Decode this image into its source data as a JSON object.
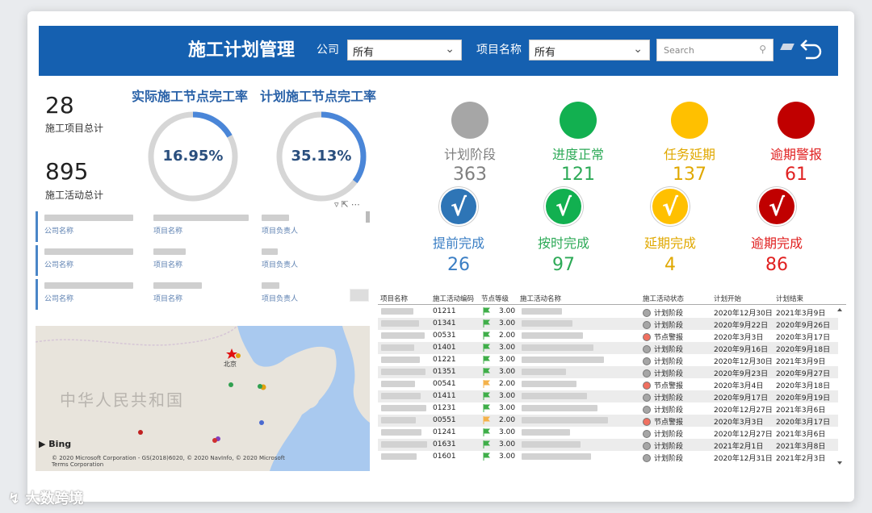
{
  "header": {
    "title": "施工计划管理",
    "company_label": "公司",
    "company_value": "所有",
    "project_label": "项目名称",
    "project_value": "所有",
    "search_placeholder": "Search"
  },
  "stats": {
    "projects_total": "28",
    "projects_label": "施工项目总计",
    "activities_total": "895",
    "activities_label": "施工活动总计"
  },
  "gauges": [
    {
      "title": "实际施工节点完工率",
      "value": "16.95%",
      "fraction": 0.1695
    },
    {
      "title": "计划施工节点完工率",
      "value": "35.13%",
      "fraction": 0.3513
    }
  ],
  "status_counts": [
    {
      "label": "计划阶段",
      "value": "363",
      "color": "#a6a6a6",
      "text_color": "#7f7f7f"
    },
    {
      "label": "进度正常",
      "value": "121",
      "color": "#12b050",
      "text_color": "#2daa57"
    },
    {
      "label": "任务延期",
      "value": "137",
      "color": "#ffc000",
      "text_color": "#e0a800"
    },
    {
      "label": "逾期警报",
      "value": "61",
      "color": "#c00000",
      "text_color": "#e02020"
    }
  ],
  "completion_counts": [
    {
      "label": "提前完成",
      "value": "26",
      "color": "#2e75b6",
      "text_color": "#3a7ec4",
      "check": "√"
    },
    {
      "label": "按时完成",
      "value": "97",
      "color": "#12b050",
      "text_color": "#2daa57",
      "check": "√"
    },
    {
      "label": "延期完成",
      "value": "4",
      "color": "#ffc000",
      "text_color": "#e0a800",
      "check": "√"
    },
    {
      "label": "逾期完成",
      "value": "86",
      "color": "#c00000",
      "text_color": "#e02020",
      "check": "√"
    }
  ],
  "list": {
    "captions": [
      "公司名称",
      "项目名称",
      "项目负责人"
    ]
  },
  "map": {
    "country_label": "中华人民共和国",
    "city_label": "北京",
    "bing_label": "Bing",
    "copyright": "© 2020 Microsoft Corporation - GS(2018)6020, © 2020 NavInfo, © 2020 Microsoft Terms Corporation"
  },
  "table": {
    "columns": [
      "项目名称",
      "施工活动编码",
      "节点等级",
      "施工活动名称",
      "施工活动状态",
      "计划开始",
      "计划结束"
    ],
    "rows": [
      {
        "code": "01211",
        "level": "3.00",
        "flag": "#3fae49",
        "status": "计划阶段",
        "status_color": "#a6a6a6",
        "start": "2020年12月30日",
        "end": "2021年3月9日"
      },
      {
        "code": "01341",
        "level": "3.00",
        "flag": "#3fae49",
        "status": "计划阶段",
        "status_color": "#a6a6a6",
        "start": "2020年9月22日",
        "end": "2020年9月26日"
      },
      {
        "code": "00531",
        "level": "2.00",
        "flag": "#3fae49",
        "status": "节点警报",
        "status_color": "#f07060",
        "start": "2020年3月3日",
        "end": "2020年3月17日"
      },
      {
        "code": "01401",
        "level": "3.00",
        "flag": "#3fae49",
        "status": "计划阶段",
        "status_color": "#a6a6a6",
        "start": "2020年9月16日",
        "end": "2020年9月18日"
      },
      {
        "code": "01221",
        "level": "3.00",
        "flag": "#3fae49",
        "status": "计划阶段",
        "status_color": "#a6a6a6",
        "start": "2020年12月30日",
        "end": "2021年3月9日"
      },
      {
        "code": "01351",
        "level": "3.00",
        "flag": "#3fae49",
        "status": "计划阶段",
        "status_color": "#a6a6a6",
        "start": "2020年9月23日",
        "end": "2020年9月27日"
      },
      {
        "code": "00541",
        "level": "2.00",
        "flag": "#f4b24a",
        "status": "节点警报",
        "status_color": "#f07060",
        "start": "2020年3月4日",
        "end": "2020年3月18日"
      },
      {
        "code": "01411",
        "level": "3.00",
        "flag": "#3fae49",
        "status": "计划阶段",
        "status_color": "#a6a6a6",
        "start": "2020年9月17日",
        "end": "2020年9月19日"
      },
      {
        "code": "01231",
        "level": "3.00",
        "flag": "#3fae49",
        "status": "计划阶段",
        "status_color": "#a6a6a6",
        "start": "2020年12月27日",
        "end": "2021年3月6日"
      },
      {
        "code": "00551",
        "level": "2.00",
        "flag": "#f4b24a",
        "status": "节点警报",
        "status_color": "#f07060",
        "start": "2020年3月3日",
        "end": "2020年3月17日"
      },
      {
        "code": "01241",
        "level": "3.00",
        "flag": "#3fae49",
        "status": "计划阶段",
        "status_color": "#a6a6a6",
        "start": "2020年12月27日",
        "end": "2021年3月6日"
      },
      {
        "code": "01631",
        "level": "3.00",
        "flag": "#3fae49",
        "status": "计划阶段",
        "status_color": "#a6a6a6",
        "start": "2021年2月1日",
        "end": "2021年3月8日"
      },
      {
        "code": "01601",
        "level": "3.00",
        "flag": "#3fae49",
        "status": "计划阶段",
        "status_color": "#a6a6a6",
        "start": "2020年12月31日",
        "end": "2021年2月3日"
      }
    ]
  },
  "watermark": "大数跨境"
}
